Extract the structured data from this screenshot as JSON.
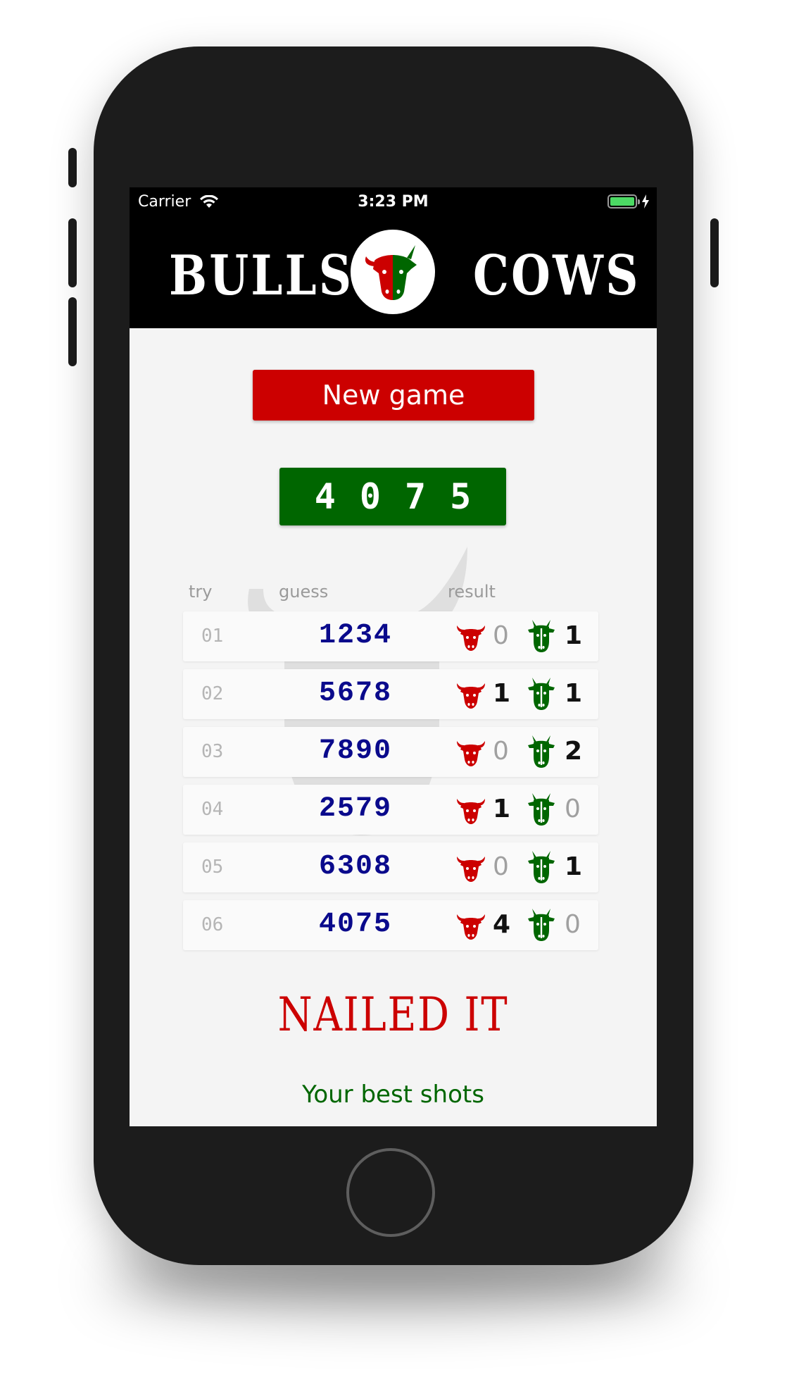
{
  "status_bar": {
    "carrier": "Carrier",
    "time": "3:23 PM"
  },
  "header": {
    "left_word": "BULLS",
    "right_word": "COWS"
  },
  "new_game_label": "New game",
  "secret_number": "4075",
  "columns": {
    "try": "try",
    "guess": "guess",
    "result": "result"
  },
  "tries": [
    {
      "try": "01",
      "guess": "1234",
      "bulls": "0",
      "cows": "1"
    },
    {
      "try": "02",
      "guess": "5678",
      "bulls": "1",
      "cows": "1"
    },
    {
      "try": "03",
      "guess": "7890",
      "bulls": "0",
      "cows": "2"
    },
    {
      "try": "04",
      "guess": "2579",
      "bulls": "1",
      "cows": "0"
    },
    {
      "try": "05",
      "guess": "6308",
      "bulls": "0",
      "cows": "1"
    },
    {
      "try": "06",
      "guess": "4075",
      "bulls": "4",
      "cows": "0"
    }
  ],
  "result_message": "NAILED IT",
  "best_shots_label": "Your best shots",
  "colors": {
    "bull_red": "#cc0000",
    "cow_green": "#006600",
    "guess_blue": "#0a0a8c"
  },
  "icons": {
    "bull": "bull-icon",
    "cow": "cow-icon",
    "logo": "bull-cow-logo"
  }
}
